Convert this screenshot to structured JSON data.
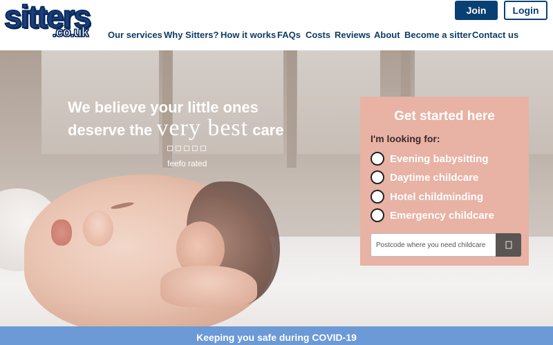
{
  "logo": {
    "main": "sitters",
    "sub": ".co.uk"
  },
  "header": {
    "join_label": "Join",
    "login_label": "Login"
  },
  "nav": {
    "items": [
      {
        "label": "Our services"
      },
      {
        "label": "Why Sitters?"
      },
      {
        "label": "How it works"
      },
      {
        "label": "FAQs"
      },
      {
        "label": "Costs"
      },
      {
        "label": "Reviews"
      },
      {
        "label": "About"
      },
      {
        "label": "Become a sitter"
      },
      {
        "label": "Contact us"
      }
    ]
  },
  "hero": {
    "headline_line1": "We believe your little ones",
    "headline_line2_prefix": "deserve the ",
    "headline_emphasis": "very best",
    "headline_line2_suffix": " care",
    "rating_label": "feefo rated",
    "star_count": 5
  },
  "panel": {
    "title": "Get started here",
    "prompt": "I'm looking for:",
    "options": [
      {
        "label": "Evening babysitting"
      },
      {
        "label": "Daytime childcare"
      },
      {
        "label": "Hotel childminding"
      },
      {
        "label": "Emergency childcare"
      }
    ],
    "postcode_placeholder": "Postcode where you need childcare",
    "search_icon": "search-icon"
  },
  "banner": {
    "text": "Keeping you safe during COVID-19"
  },
  "colors": {
    "brand_navy": "#0a3f73",
    "panel_pink": "#e8b2a4",
    "banner_blue": "#6b9ad6"
  }
}
